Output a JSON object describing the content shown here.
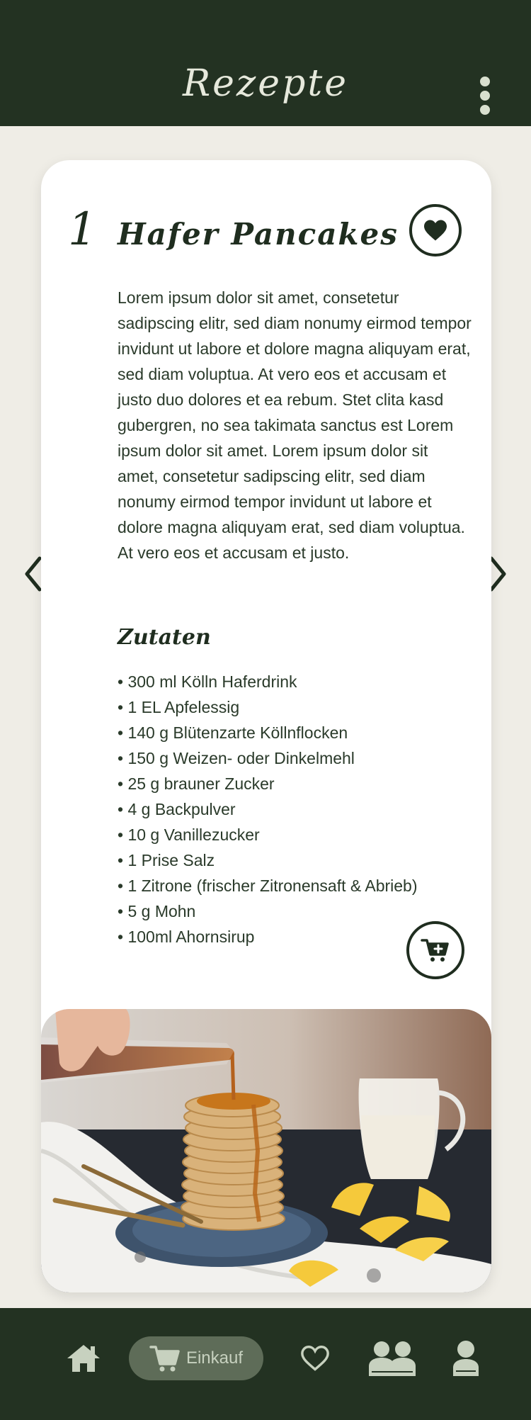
{
  "header": {
    "title": "Rezepte",
    "menu_icon": "more-vertical-icon"
  },
  "recipe": {
    "number": "1",
    "title": "Hafer Pancakes",
    "favorite_icon": "heart-icon",
    "description": "Lorem ipsum dolor sit amet, consetetur sadipscing elitr, sed diam nonumy eirmod tempor invidunt ut labore et dolore magna aliquyam erat, sed diam voluptua. At vero eos et accusam et justo duo dolores et ea rebum. Stet clita kasd gubergren, no sea takimata sanctus est Lorem ipsum dolor sit amet. Lorem ipsum dolor sit amet, consetetur sadipscing elitr, sed diam nonumy eirmod tempor invidunt ut labore et dolore magna aliquyam erat, sed diam voluptua. At vero eos et accusam et justo.",
    "ingredients_heading": "Zutaten",
    "ingredients": [
      "300 ml Kölln Haferdrink",
      "1 EL Apfelessig",
      "140 g Blütenzarte Köllnflocken",
      "150 g Weizen- oder Dinkelmehl",
      "25 g brauner Zucker",
      "4 g Backpulver",
      "10 g Vanillezucker",
      "1 Prise Salz",
      "1 Zitrone (frischer Zitronensaft & Abrieb)",
      "5 g Mohn",
      "100ml Ahornsirup"
    ],
    "add_to_cart_icon": "cart-plus-icon"
  },
  "navigation": {
    "prev_icon": "chevron-left-icon",
    "next_icon": "chevron-right-icon"
  },
  "bottom_nav": {
    "home_icon": "home-icon",
    "shopping_label": "Einkauf",
    "shopping_icon": "cart-icon",
    "favorites_icon": "heart-outline-icon",
    "community_icon": "users-icon",
    "profile_icon": "user-icon",
    "active": "Einkauf"
  },
  "colors": {
    "primary_dark": "#233222",
    "background": "#efede6",
    "card": "#ffffff",
    "text_light": "#e6e9dc",
    "nav_active_bg": "#5e6c58"
  }
}
